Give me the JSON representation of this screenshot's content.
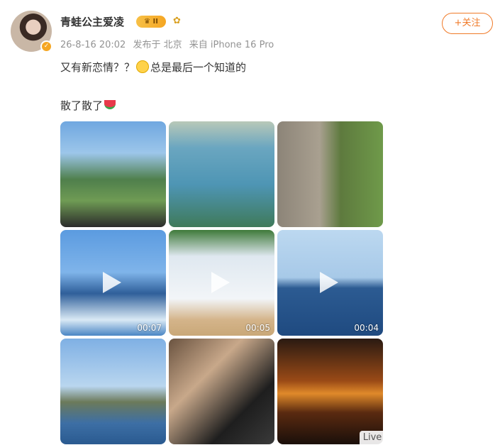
{
  "post": {
    "username": "青蛙公主爱凌",
    "vip_level": "II",
    "meta": {
      "date": "26-8-16 20:02",
      "location": "发布于 北京",
      "device": "来自 iPhone 16 Pro"
    },
    "follow_label": "+关注",
    "text_line1_a": "又有新恋情？？",
    "text_line1_b": "总是最后一个知道的",
    "text_line2": "散了散了",
    "media": [
      {
        "kind": "photo"
      },
      {
        "kind": "photo"
      },
      {
        "kind": "photo"
      },
      {
        "kind": "video",
        "duration": "00:07"
      },
      {
        "kind": "video",
        "duration": "00:05"
      },
      {
        "kind": "video",
        "duration": "00:04"
      },
      {
        "kind": "photo"
      },
      {
        "kind": "photo"
      },
      {
        "kind": "photo",
        "badge": "Live"
      }
    ]
  },
  "icons": {
    "emoji_1": "sweat-smile-emoji-icon",
    "emoji_2": "watermelon-emoji-icon",
    "play": "play-icon"
  },
  "colors": {
    "accent": "#f07a28",
    "meta_text": "#939393",
    "vip_gold": "#f5a623"
  }
}
